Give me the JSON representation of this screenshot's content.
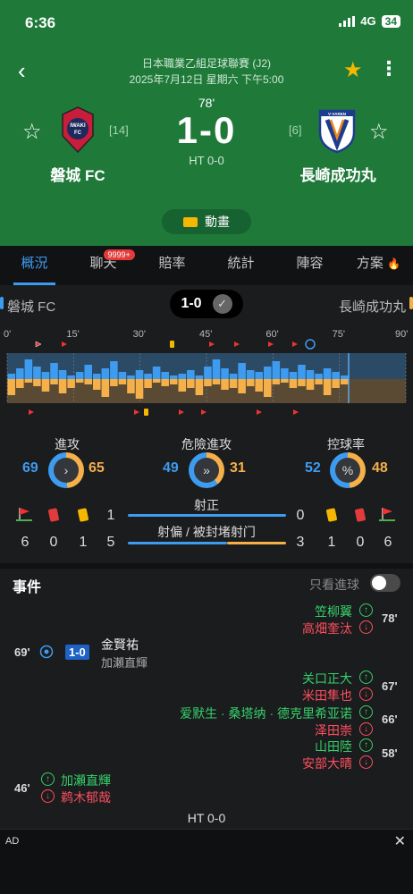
{
  "status": {
    "time": "6:36",
    "network": "4G",
    "battery": "34"
  },
  "match": {
    "league": "日本職業乙組足球聯賽 (J2)",
    "date": "2025年7月12日 星期六 下午5:00",
    "minute": "78'",
    "score": "1-0",
    "halftime": "HT 0-0",
    "home": {
      "name": "磐城 FC",
      "rank": "[14]",
      "logo_text": "IWAKI FC"
    },
    "away": {
      "name": "長崎成功丸",
      "rank": "[6]",
      "logo_text": "V-VAREN"
    },
    "animation": "動畫"
  },
  "tabs": {
    "overview": "概況",
    "chat": "聊天",
    "chat_badge": "9999+",
    "odds": "賠率",
    "stats": "統計",
    "lineup": "陣容",
    "plan": "方案"
  },
  "summary": {
    "home": "磐城 FC",
    "score": "1-0",
    "away": "長崎成功丸"
  },
  "timeline": {
    "labels": [
      "0'",
      "15'",
      "30'",
      "45'",
      "60'",
      "75'",
      "90'"
    ]
  },
  "stats": {
    "attack": {
      "label": "進攻",
      "home": "69",
      "away": "65",
      "home_frac": 0.51
    },
    "danger": {
      "label": "危險進攻",
      "home": "49",
      "away": "31",
      "home_frac": 0.61
    },
    "possession": {
      "label": "控球率",
      "home": "52",
      "away": "48",
      "home_frac": 0.52
    },
    "on_target": {
      "label": "射正",
      "home": "1",
      "away": "0"
    },
    "off_target": {
      "label": "射偏 / 被封堵射门",
      "home": "5",
      "away": "3"
    },
    "home_counts": {
      "corners": "6",
      "red": "0",
      "yellow": "1"
    },
    "away_counts": {
      "yellow": "1",
      "red": "0",
      "corners": "6"
    }
  },
  "events": {
    "title": "事件",
    "goals_only": "只看進球",
    "halftime": "HT 0-0",
    "sub78_in": "笠柳翼",
    "sub78_out": "高畑奎汰",
    "min78": "78'",
    "goal_min": "69'",
    "goal_score": "1-0",
    "goal_scorer": "金賢祐",
    "goal_assist": "加瀬直輝",
    "sub67a_in": "关口正大",
    "sub67a_out": "米田隼也",
    "min67": "67'",
    "sub66_in": "爱默生 · 桑塔纳 · 德克里希亚诺",
    "sub66_out": "泽田崇",
    "min66": "66'",
    "sub58_in": "山田陸",
    "sub58_out": "安部大晴",
    "min58": "58'",
    "sub46_in": "加瀬直輝",
    "sub46_out": "鹈木郁哉",
    "min46": "46'"
  },
  "ad": {
    "label": "AD",
    "close": "✕"
  },
  "icons": {
    "back": "back-arrow-icon",
    "star": "star-icon",
    "more": "more-icon"
  }
}
